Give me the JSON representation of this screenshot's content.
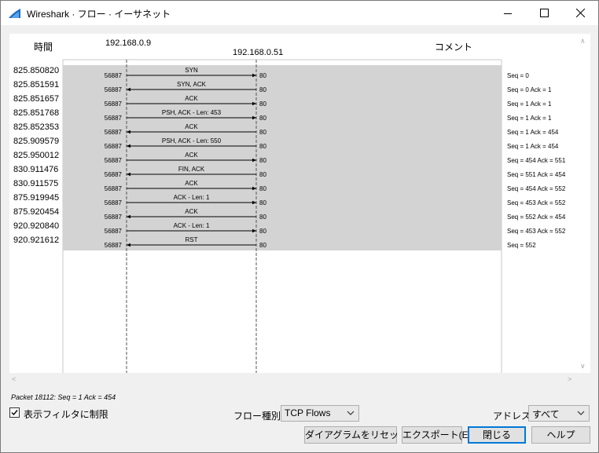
{
  "window": {
    "title": "Wireshark · フロー · イーサネット",
    "minimize_icon": "minimize-icon",
    "maximize_icon": "maximize-icon",
    "close_icon": "close-icon"
  },
  "flow": {
    "col_time": "時間",
    "col_comment": "コメント",
    "host_a": "192.168.0.9",
    "host_b": "192.168.0.51",
    "rows": [
      {
        "time": "825.850820",
        "dir": "right",
        "label": "SYN",
        "port_a": "56887",
        "port_b": "80",
        "comment": "Seq = 0"
      },
      {
        "time": "825.851591",
        "dir": "left",
        "label": "SYN, ACK",
        "port_a": "56887",
        "port_b": "80",
        "comment": "Seq = 0 Ack = 1"
      },
      {
        "time": "825.851657",
        "dir": "right",
        "label": "ACK",
        "port_a": "56887",
        "port_b": "80",
        "comment": "Seq = 1 Ack = 1"
      },
      {
        "time": "825.851768",
        "dir": "right",
        "label": "PSH, ACK - Len: 453",
        "port_a": "56887",
        "port_b": "80",
        "comment": "Seq = 1 Ack = 1"
      },
      {
        "time": "825.852353",
        "dir": "left",
        "label": "ACK",
        "port_a": "56887",
        "port_b": "80",
        "comment": "Seq = 1 Ack = 454"
      },
      {
        "time": "825.909579",
        "dir": "left",
        "label": "PSH, ACK - Len: 550",
        "port_a": "56887",
        "port_b": "80",
        "comment": "Seq = 1 Ack = 454"
      },
      {
        "time": "825.950012",
        "dir": "right",
        "label": "ACK",
        "port_a": "56887",
        "port_b": "80",
        "comment": "Seq = 454 Ack = 551"
      },
      {
        "time": "830.911476",
        "dir": "left",
        "label": "FIN, ACK",
        "port_a": "56887",
        "port_b": "80",
        "comment": "Seq = 551 Ack = 454"
      },
      {
        "time": "830.911575",
        "dir": "right",
        "label": "ACK",
        "port_a": "56887",
        "port_b": "80",
        "comment": "Seq = 454 Ack = 552"
      },
      {
        "time": "875.919945",
        "dir": "right",
        "label": "ACK - Len: 1",
        "port_a": "56887",
        "port_b": "80",
        "comment": "Seq = 453 Ack = 552"
      },
      {
        "time": "875.920454",
        "dir": "left",
        "label": "ACK",
        "port_a": "56887",
        "port_b": "80",
        "comment": "Seq = 552 Ack = 454"
      },
      {
        "time": "920.920840",
        "dir": "right",
        "label": "ACK - Len: 1",
        "port_a": "56887",
        "port_b": "80",
        "comment": "Seq = 453 Ack = 552"
      },
      {
        "time": "920.921612",
        "dir": "left",
        "label": "RST",
        "port_a": "56887",
        "port_b": "80",
        "comment": "Seq = 552"
      }
    ]
  },
  "status": {
    "text": "Packet 18112: Seq = 1 Ack = 454"
  },
  "controls": {
    "limit_checkbox_label": "表示フィルタに制限",
    "limit_checked": true,
    "flow_type_label": "フロー種別:",
    "flow_type_value": "TCP Flows",
    "address_label": "アドレス:",
    "address_value": "すべて",
    "reset_button": "ダイアグラムをリセット(R)",
    "export_button": "エクスポート(E)",
    "close_button": "閉じる",
    "help_button": "ヘルプ"
  },
  "colors": {
    "selection_band": "#d3d3d3",
    "default_button_border": "#0078d7",
    "app_icon": "#1f6ec4"
  }
}
